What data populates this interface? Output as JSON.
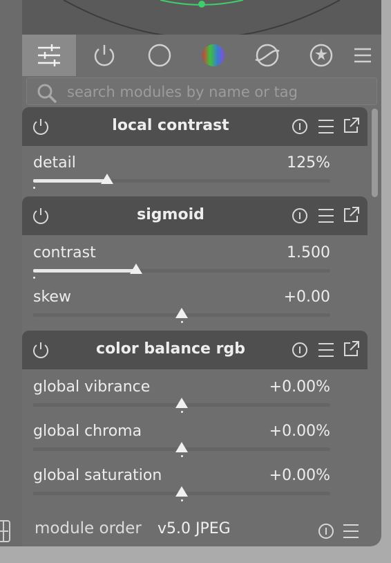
{
  "tabs": [
    {
      "name": "active-modules-icon",
      "active": true
    },
    {
      "name": "power-icon",
      "active": false
    },
    {
      "name": "circle-icon",
      "active": false
    },
    {
      "name": "color-circle-icon",
      "active": false
    },
    {
      "name": "tone-curve-icon",
      "active": false
    },
    {
      "name": "effects-icon",
      "active": false
    },
    {
      "name": "hamburger-menu-icon",
      "active": false
    }
  ],
  "search": {
    "placeholder": "search modules by name or tag"
  },
  "modules": [
    {
      "title": "local contrast",
      "params": [
        {
          "label": "detail",
          "value": "125%"
        }
      ]
    },
    {
      "title": "sigmoid",
      "params": [
        {
          "label": "contrast",
          "value": "1.500"
        },
        {
          "label": "skew",
          "value": "+0.00"
        }
      ]
    },
    {
      "title": "color balance rgb",
      "params": [
        {
          "label": "global vibrance",
          "value": "+0.00%"
        },
        {
          "label": "global chroma",
          "value": "+0.00%"
        },
        {
          "label": "global saturation",
          "value": "+0.00%"
        }
      ]
    }
  ],
  "footer": {
    "label": "module order",
    "value": "v5.0 JPEG"
  },
  "colors": {
    "panel": "#6e6e6e",
    "header": "#4f4f4f",
    "accent_green": "#3ecf6a"
  }
}
